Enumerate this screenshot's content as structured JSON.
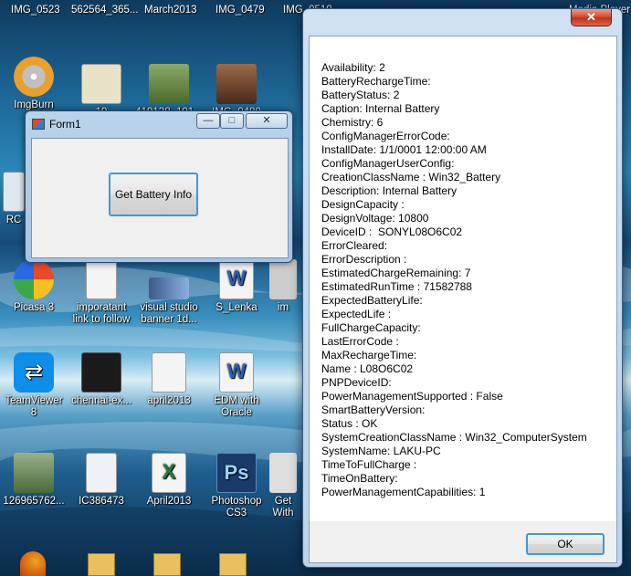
{
  "desktop": {
    "top_labels": [
      "IMG_0523",
      "562564_365...",
      "March2013",
      "IMG_0479",
      "IMG_0510",
      "Media Player"
    ],
    "icons": [
      {
        "label": "ImgBurn",
        "icon": "imgburn-disc-icon",
        "color": "#c9a24a"
      },
      {
        "label": "19",
        "icon": "image-file-icon",
        "color": "#e8e2c8"
      },
      {
        "label": "419138_101...",
        "icon": "image-file-icon",
        "color": "#5a7a3a"
      },
      {
        "label": "IMG_0480",
        "icon": "image-file-icon",
        "color": "#6a3a2a"
      },
      {
        "label": "RC",
        "icon": "document-icon",
        "color": "#dfe8f0"
      },
      {
        "label": "Picasa 3",
        "icon": "picasa-icon",
        "color": "#e84a2a"
      },
      {
        "label": "imporatant\nlink to follow",
        "icon": "text-document-icon",
        "color": "#f4f4f4"
      },
      {
        "label": "visual studio\nbanner 1d...",
        "icon": "image-file-icon",
        "color": "#3a5a8a"
      },
      {
        "label": "S_Lenka",
        "icon": "word-document-icon",
        "color": "#2b5fb0"
      },
      {
        "label": "im",
        "icon": "image-file-icon",
        "color": "#ccc"
      },
      {
        "label": "TeamViewer\n8",
        "icon": "teamviewer-icon",
        "color": "#0e8ee9"
      },
      {
        "label": "chennai-ex...",
        "icon": "image-file-icon",
        "color": "#1a1a1a"
      },
      {
        "label": "april2013",
        "icon": "pdf-document-icon",
        "color": "#f4f4f4"
      },
      {
        "label": "EDM with\nOracle",
        "icon": "word-document-icon",
        "color": "#2b5fb0"
      },
      {
        "label": "126965762...",
        "icon": "photo-icon",
        "color": "#4a6a3a"
      },
      {
        "label": "IC386473",
        "icon": "image-file-icon",
        "color": "#eef2f6"
      },
      {
        "label": "April2013",
        "icon": "excel-document-icon",
        "color": "#1e7a3a"
      },
      {
        "label": "Photoshop\nCS3",
        "icon": "photoshop-icon",
        "color": "#1a3a6a"
      },
      {
        "label": "Get\nWith",
        "icon": "document-icon",
        "color": "#ddd"
      }
    ]
  },
  "form1": {
    "title": "Form1",
    "minimize": "—",
    "maximize": "□",
    "close": "✕",
    "button_label": "Get Battery Info"
  },
  "msgbox": {
    "close": "✕",
    "lines": [
      "Availability: 2",
      "BatteryRechargeTime:",
      "BatteryStatus: 2",
      "Caption: Internal Battery",
      "Chemistry: 6",
      "ConfigManagerErrorCode:",
      "InstallDate: 1/1/0001 12:00:00 AM",
      "ConfigManagerUserConfig:",
      "CreationClassName : Win32_Battery",
      "Description: Internal Battery",
      "DesignCapacity :",
      "DesignVoltage: 10800",
      "DeviceID :  SONYL08O6C02",
      "ErrorCleared:",
      "ErrorDescription :",
      "EstimatedChargeRemaining: 7",
      "EstimatedRunTime : 71582788",
      "ExpectedBatteryLife:",
      "ExpectedLife :",
      "FullChargeCapacity:",
      "LastErrorCode :",
      "MaxRechargeTime:",
      "Name : L08O6C02",
      "PNPDeviceID:",
      "PowerManagementSupported : False",
      "SmartBatteryVersion:",
      "Status : OK",
      "SystemCreationClassName : Win32_ComputerSystem",
      "SystemName: LAKU-PC",
      "TimeToFullCharge :",
      "TimeOnBattery:",
      "PowerManagementCapabilities: 1"
    ],
    "ok_label": "OK"
  },
  "colors": {
    "focus_border": "#3c9ad6",
    "close_red": "#c0301c"
  }
}
